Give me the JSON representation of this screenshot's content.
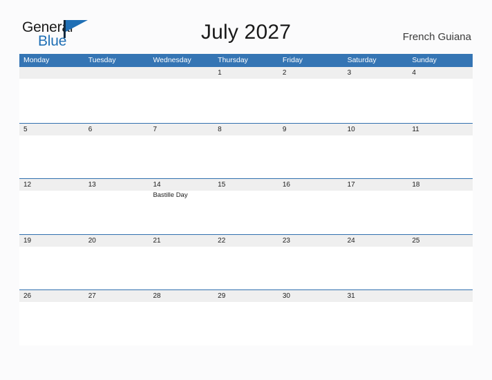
{
  "brand": {
    "name_part1": "General",
    "name_part2": "Blue",
    "accent_color": "#1f6fb5"
  },
  "header": {
    "title": "July 2027",
    "location": "French Guiana"
  },
  "calendar": {
    "header_color": "#3575b4",
    "row_band_color": "#efefef",
    "rule_color": "#2f6fae",
    "weekdays": [
      "Monday",
      "Tuesday",
      "Wednesday",
      "Thursday",
      "Friday",
      "Saturday",
      "Sunday"
    ],
    "weeks": [
      [
        {
          "day": ""
        },
        {
          "day": ""
        },
        {
          "day": ""
        },
        {
          "day": "1"
        },
        {
          "day": "2"
        },
        {
          "day": "3"
        },
        {
          "day": "4"
        }
      ],
      [
        {
          "day": "5"
        },
        {
          "day": "6"
        },
        {
          "day": "7"
        },
        {
          "day": "8"
        },
        {
          "day": "9"
        },
        {
          "day": "10"
        },
        {
          "day": "11"
        }
      ],
      [
        {
          "day": "12"
        },
        {
          "day": "13"
        },
        {
          "day": "14",
          "event": "Bastille Day"
        },
        {
          "day": "15"
        },
        {
          "day": "16"
        },
        {
          "day": "17"
        },
        {
          "day": "18"
        }
      ],
      [
        {
          "day": "19"
        },
        {
          "day": "20"
        },
        {
          "day": "21"
        },
        {
          "day": "22"
        },
        {
          "day": "23"
        },
        {
          "day": "24"
        },
        {
          "day": "25"
        }
      ],
      [
        {
          "day": "26"
        },
        {
          "day": "27"
        },
        {
          "day": "28"
        },
        {
          "day": "29"
        },
        {
          "day": "30"
        },
        {
          "day": "31"
        },
        {
          "day": ""
        }
      ]
    ]
  }
}
